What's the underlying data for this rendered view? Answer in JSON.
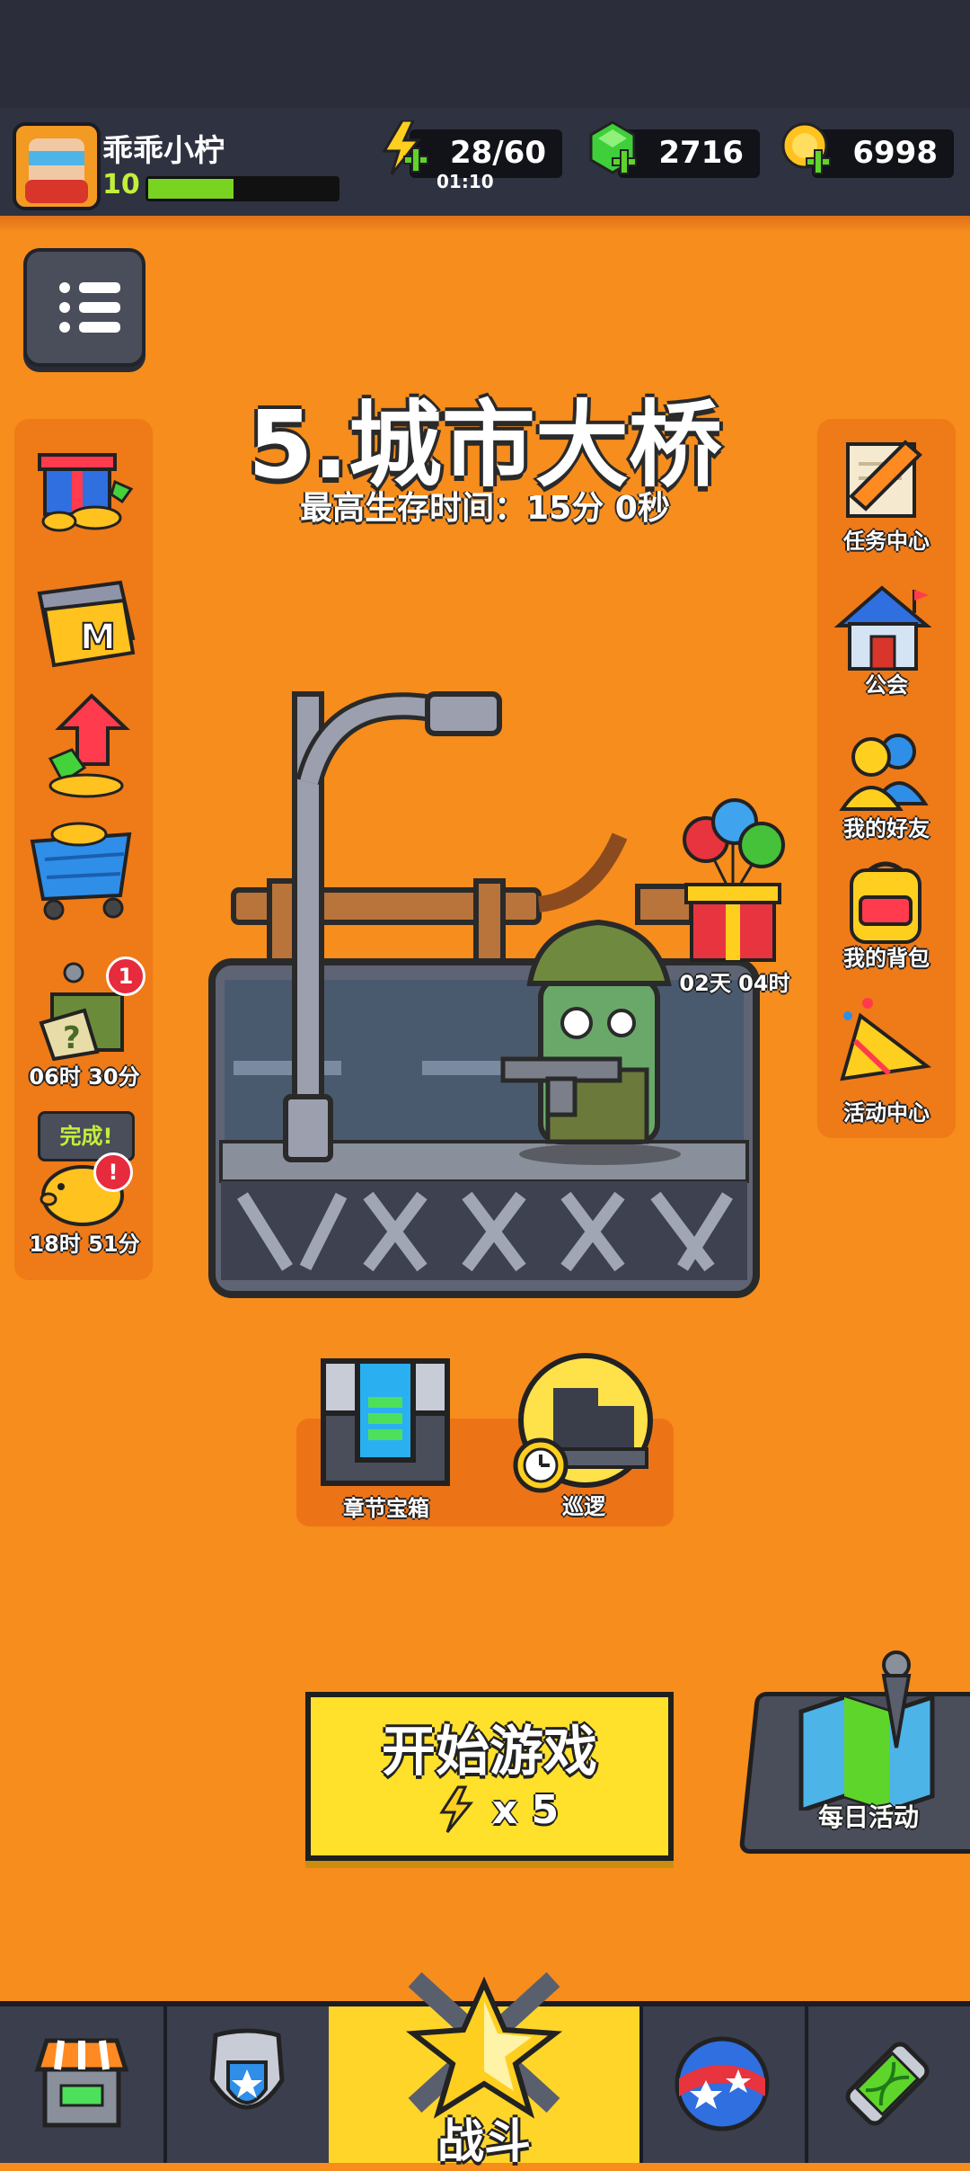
{
  "player": {
    "name": "乖乖小柠",
    "level": "10",
    "xp_fraction": 0.45
  },
  "resources": {
    "energy": "28/60",
    "energy_timer": "01:10",
    "gems": "2716",
    "coins": "6998"
  },
  "stage": {
    "title": "5.城市大桥",
    "best_survival": "最高生存时间：15分 0秒"
  },
  "left_sidebar": {
    "supply_timer": "06时 30分",
    "supply_badge": "1",
    "piggy_status": "完成!",
    "piggy_badge": "!",
    "piggy_timer": "18时 51分"
  },
  "right_sidebar": {
    "items": [
      {
        "label": "任务中心",
        "icon": "scroll-pencil-icon"
      },
      {
        "label": "公会",
        "icon": "guild-house-icon"
      },
      {
        "label": "我的好友",
        "icon": "friends-icon"
      },
      {
        "label": "我的背包",
        "icon": "backpack-icon"
      },
      {
        "label": "活动中心",
        "icon": "party-horn-icon"
      }
    ]
  },
  "gift_event": {
    "timer": "02天 04时"
  },
  "chapter_chest": {
    "label": "章节宝箱"
  },
  "patrol": {
    "label": "巡逻"
  },
  "start_game": {
    "label": "开始游戏",
    "cost": "x 5"
  },
  "daily_activity": {
    "label": "每日活动"
  },
  "bottom_nav": {
    "battle_label": "战斗",
    "tabs": [
      "shop-icon",
      "shield-badge-icon",
      "battle-star-icon",
      "skills-orb-icon",
      "gene-capsule-icon"
    ]
  },
  "colors": {
    "background": "#f68d1c",
    "start_button": "#ffe02a",
    "xp_fill": "#79d321",
    "nav_active": "#ffd52a"
  }
}
